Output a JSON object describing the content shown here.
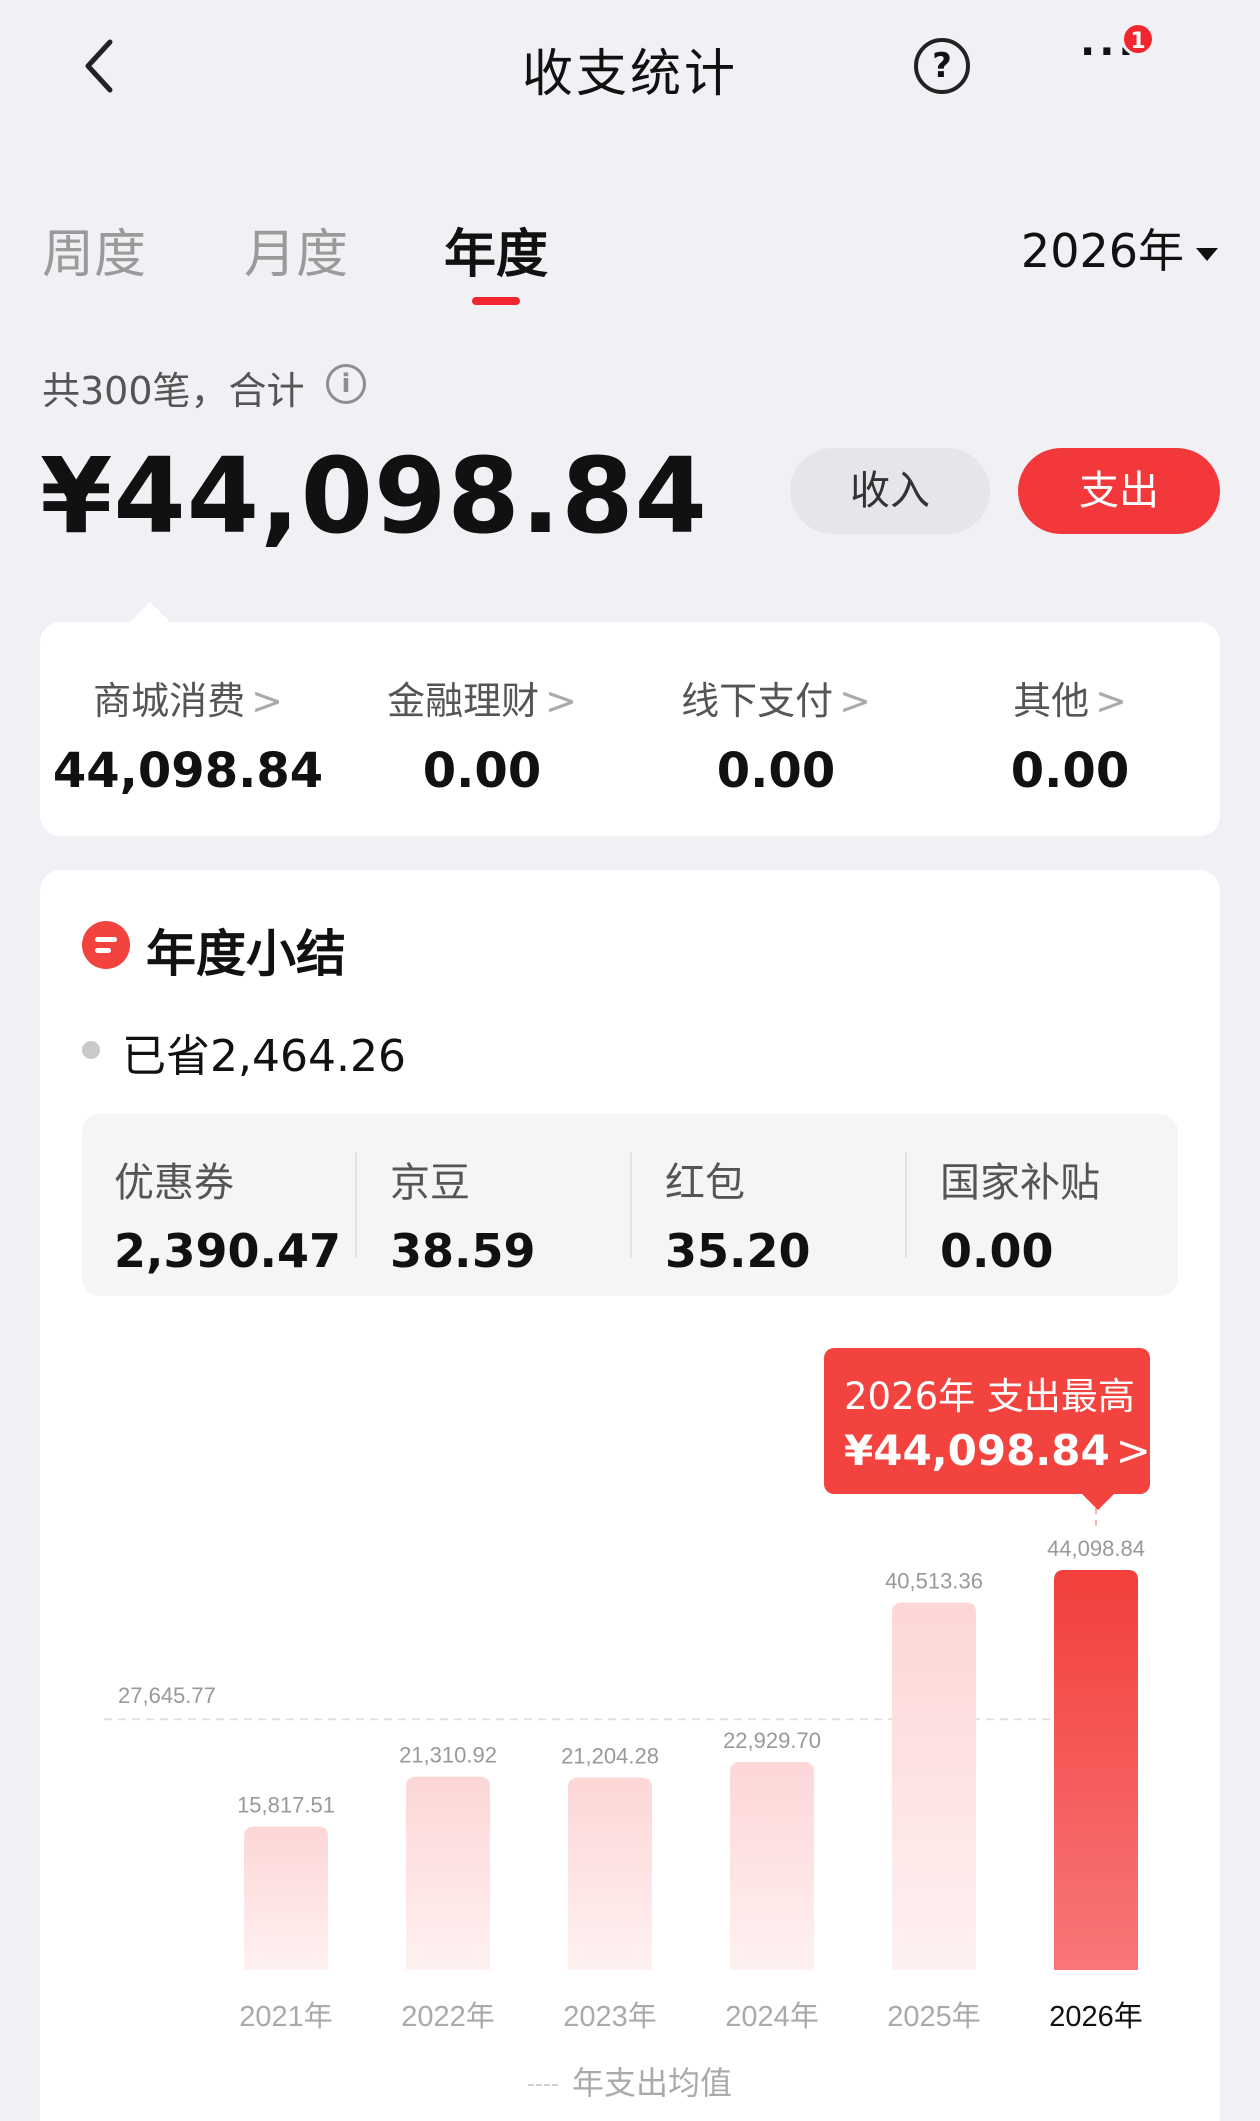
{
  "nav": {
    "title": "收支统计",
    "help_glyph": "?",
    "more_glyph": "···",
    "badge_count": "1"
  },
  "tabs": [
    {
      "label": "周度",
      "active": false
    },
    {
      "label": "月度",
      "active": false
    },
    {
      "label": "年度",
      "active": true
    }
  ],
  "year_selector": {
    "label": "2026年"
  },
  "summary": {
    "count_label": "共300笔，合计",
    "info_glyph": "i",
    "amount": "¥44,098.84",
    "toggle": {
      "income": "收入",
      "expense": "支出",
      "selected": "支出"
    }
  },
  "categories": [
    {
      "name": "商城消费",
      "value": "44,098.84"
    },
    {
      "name": "金融理财",
      "value": "0.00"
    },
    {
      "name": "线下支付",
      "value": "0.00"
    },
    {
      "name": "其他",
      "value": "0.00"
    }
  ],
  "chevron": ">",
  "year_summary": {
    "title": "年度小结",
    "saved": "已省2,464.26",
    "discounts": [
      {
        "name": "优惠券",
        "value": "2,390.47"
      },
      {
        "name": "京豆",
        "value": "38.59"
      },
      {
        "name": "红包",
        "value": "35.20"
      },
      {
        "name": "国家补贴",
        "value": "0.00"
      }
    ]
  },
  "tooltip": {
    "title": "2026年 支出最高",
    "value": "¥44,098.84"
  },
  "colors": {
    "accent": "#f2383a",
    "bar_light": "#fddcdc",
    "bar_highlight": "#f24440"
  },
  "chart_data": {
    "type": "bar",
    "categories": [
      "2021年",
      "2022年",
      "2023年",
      "2024年",
      "2025年",
      "2026年"
    ],
    "values": [
      15817.51,
      21310.92,
      21204.28,
      22929.7,
      40513.36,
      44098.84
    ],
    "value_labels": [
      "15,817.51",
      "21,310.92",
      "21,204.28",
      "22,929.70",
      "40,513.36",
      "44,098.84"
    ],
    "highlight_index": 5,
    "average": {
      "value": 27645.77,
      "label": "27,645.77",
      "legend": "年支出均值"
    },
    "ylim": [
      0,
      44098.84
    ],
    "grid": false
  }
}
